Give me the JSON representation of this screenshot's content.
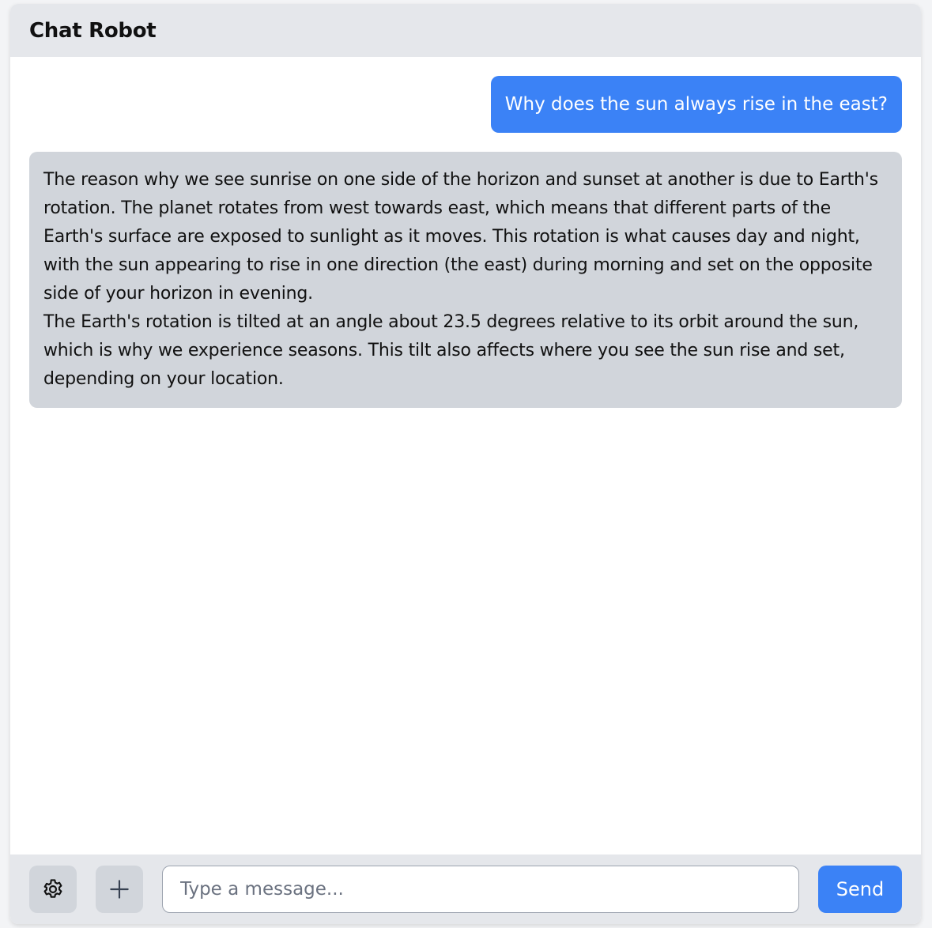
{
  "app": {
    "title": "Chat Robot"
  },
  "messages": [
    {
      "role": "user",
      "text": "Why does the sun always rise in the east?"
    },
    {
      "role": "bot",
      "text": "The reason why we see sunrise on one side of the horizon and sunset at another is due to Earth's rotation. The planet rotates from west towards east, which means that different parts of the Earth's surface are exposed to sunlight as it moves. This rotation is what causes day and night, with the sun appearing to rise in one direction (the east) during morning and set on the opposite side of your horizon in evening.\nThe Earth's rotation is tilted at an angle about 23.5 degrees relative to its orbit around the sun, which is why we experience seasons. This tilt also affects where you see the sun rise and set, depending on your location."
    }
  ],
  "composer": {
    "settings_icon": "gear-icon",
    "add_icon": "plus-icon",
    "placeholder": "Type a message...",
    "value": "",
    "send_label": "Send"
  },
  "colors": {
    "accent": "#3b82f6",
    "header_bg": "#e5e7eb",
    "bot_bubble_bg": "#d1d5db"
  }
}
